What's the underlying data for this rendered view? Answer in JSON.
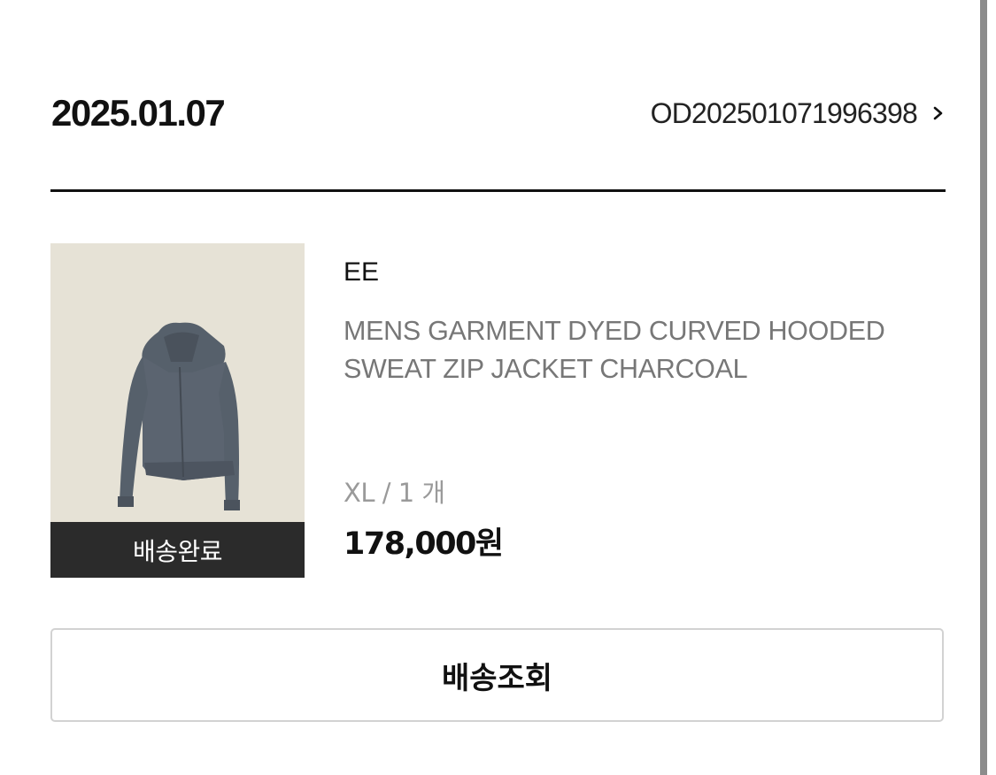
{
  "order": {
    "date": "2025.01.07",
    "number": "OD202501071996398"
  },
  "product": {
    "brand": "EE",
    "name": "MENS GARMENT DYED CURVED HOODED SWEAT ZIP JACKET CHARCOAL",
    "option": "XL / 1 개",
    "price": "178,000원",
    "status": "배송완료",
    "image_colors": {
      "background": "#e6e2d6",
      "garment": "#5b6470"
    }
  },
  "actions": {
    "tracking_label": "배송조회"
  },
  "icons": {
    "order_link": "chevron-right-icon"
  }
}
